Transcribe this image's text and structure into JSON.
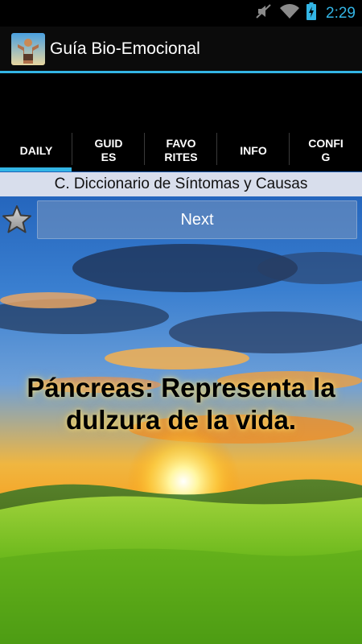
{
  "status_bar": {
    "time": "2:29",
    "icons": [
      "mute-icon",
      "wifi-icon",
      "battery-charging-icon"
    ]
  },
  "app": {
    "title": "Guía Bio-Emocional",
    "accent": "#33b5e5"
  },
  "tabs": [
    {
      "label": "DAILY",
      "selected": true
    },
    {
      "label": "GUIDES",
      "selected": false
    },
    {
      "label": "FAVORITES",
      "selected": false
    },
    {
      "label": "INFO",
      "selected": false
    },
    {
      "label": "CONFIG",
      "selected": false
    }
  ],
  "category": "C. Diccionario de Síntomas y Causas",
  "favorite_icon": "star-icon",
  "next_label": "Next",
  "quote": "Páncreas: Representa la dulzura de la vida."
}
